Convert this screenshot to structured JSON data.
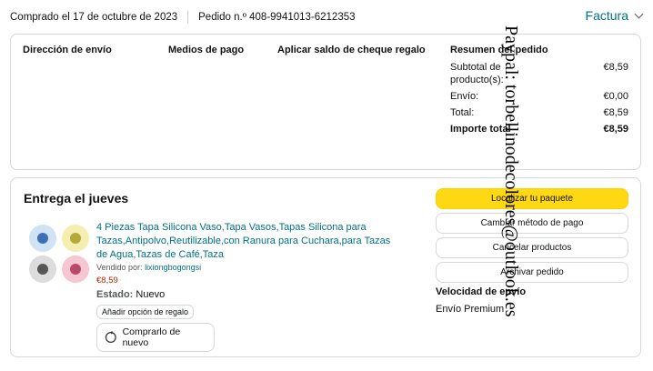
{
  "header": {
    "ordered": "Comprado el 17 de octubre de 2023",
    "order_number": "Pedido n.º 408-9941013-6212353",
    "invoice": "Factura"
  },
  "details": {
    "shipping_address": "Dirección de envío",
    "payment_methods": "Medios de pago",
    "gift_balance": "Aplicar saldo de cheque regalo",
    "summary": {
      "title": "Resumen del pedido",
      "rows": [
        {
          "label": "Subtotal de producto(s):",
          "value": "€8,59"
        },
        {
          "label": "Envío:",
          "value": "€0,00"
        },
        {
          "label": "Total:",
          "value": "€8,59"
        },
        {
          "label": "Importe total",
          "value": "€8,59"
        }
      ]
    }
  },
  "watermark": "Paypal: torbellinodecolores@outlook.es",
  "delivery": {
    "title": "Entrega el jueves",
    "product": {
      "title": "4 Piezas Tapa Silicona Vaso,Tapa Vasos,Tapas Silicona para Tazas,Antipolvo,Reutilizable,con Ranura para Cuchara,para Tazas de Agua,Tazas de Café,Taza",
      "seller_label": "Vendido por:",
      "seller": "lixiongbogongsi",
      "price": "€8,59",
      "state_label": "Estado:",
      "state": "Nuevo",
      "gift_option": "Añadir opción de regalo",
      "buy_again": "Comprarlo de nuevo"
    },
    "actions": {
      "track": "Localizar tu paquete",
      "change_payment": "Cambiar método de pago",
      "cancel": "Cancelar productos",
      "archive": "Archivar pedido"
    },
    "speed_label": "Velocidad de envío",
    "speed_value": "Envío Premium"
  },
  "colors": {
    "link": "#007185",
    "price": "#b12704",
    "primary_button": "#ffd814",
    "border": "#d5d9d9"
  },
  "icons": [
    "chevron-down-icon",
    "buy-again-icon"
  ]
}
